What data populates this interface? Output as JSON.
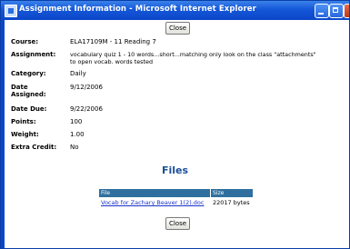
{
  "window": {
    "title": "Assignment Information - Microsoft Internet Explorer"
  },
  "buttons": {
    "close_top": "Close",
    "close_bottom": "Close"
  },
  "fields": [
    {
      "label": "Course:",
      "value": "ELA17109M - 11 Reading 7"
    },
    {
      "label": "Assignment:",
      "value": "vocabulary quiz 1 - 10 words...short...matching only look on the class \"attachments\"",
      "value2": "to open vocab. words tested"
    },
    {
      "label": "Category:",
      "value": "Daily"
    },
    {
      "label": "Date",
      "label2": "Assigned:",
      "value": "9/12/2006"
    },
    {
      "label": "Date Due:",
      "value": "9/22/2006"
    },
    {
      "label": "Points:",
      "value": "100"
    },
    {
      "label": "Weight:",
      "value": "1.00"
    },
    {
      "label": "Extra Credit:",
      "value": "No"
    }
  ],
  "files": {
    "title": "Files",
    "header": {
      "file": "File",
      "size": "Size"
    },
    "rows": [
      {
        "file": "Vocab for Zachary Beaver 1(2).doc",
        "size": "22017 bytes"
      }
    ]
  }
}
